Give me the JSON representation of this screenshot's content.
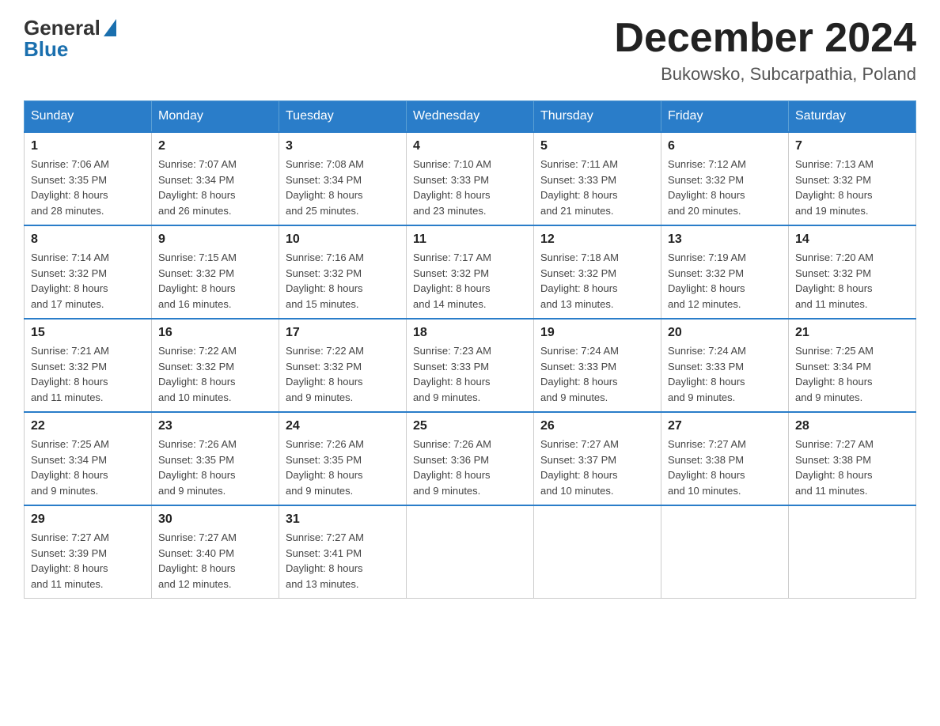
{
  "logo": {
    "general": "General",
    "blue": "Blue"
  },
  "header": {
    "title": "December 2024",
    "location": "Bukowsko, Subcarpathia, Poland"
  },
  "weekdays": [
    "Sunday",
    "Monday",
    "Tuesday",
    "Wednesday",
    "Thursday",
    "Friday",
    "Saturday"
  ],
  "weeks": [
    [
      {
        "day": "1",
        "sunrise": "7:06 AM",
        "sunset": "3:35 PM",
        "daylight": "8 hours and 28 minutes."
      },
      {
        "day": "2",
        "sunrise": "7:07 AM",
        "sunset": "3:34 PM",
        "daylight": "8 hours and 26 minutes."
      },
      {
        "day": "3",
        "sunrise": "7:08 AM",
        "sunset": "3:34 PM",
        "daylight": "8 hours and 25 minutes."
      },
      {
        "day": "4",
        "sunrise": "7:10 AM",
        "sunset": "3:33 PM",
        "daylight": "8 hours and 23 minutes."
      },
      {
        "day": "5",
        "sunrise": "7:11 AM",
        "sunset": "3:33 PM",
        "daylight": "8 hours and 21 minutes."
      },
      {
        "day": "6",
        "sunrise": "7:12 AM",
        "sunset": "3:32 PM",
        "daylight": "8 hours and 20 minutes."
      },
      {
        "day": "7",
        "sunrise": "7:13 AM",
        "sunset": "3:32 PM",
        "daylight": "8 hours and 19 minutes."
      }
    ],
    [
      {
        "day": "8",
        "sunrise": "7:14 AM",
        "sunset": "3:32 PM",
        "daylight": "8 hours and 17 minutes."
      },
      {
        "day": "9",
        "sunrise": "7:15 AM",
        "sunset": "3:32 PM",
        "daylight": "8 hours and 16 minutes."
      },
      {
        "day": "10",
        "sunrise": "7:16 AM",
        "sunset": "3:32 PM",
        "daylight": "8 hours and 15 minutes."
      },
      {
        "day": "11",
        "sunrise": "7:17 AM",
        "sunset": "3:32 PM",
        "daylight": "8 hours and 14 minutes."
      },
      {
        "day": "12",
        "sunrise": "7:18 AM",
        "sunset": "3:32 PM",
        "daylight": "8 hours and 13 minutes."
      },
      {
        "day": "13",
        "sunrise": "7:19 AM",
        "sunset": "3:32 PM",
        "daylight": "8 hours and 12 minutes."
      },
      {
        "day": "14",
        "sunrise": "7:20 AM",
        "sunset": "3:32 PM",
        "daylight": "8 hours and 11 minutes."
      }
    ],
    [
      {
        "day": "15",
        "sunrise": "7:21 AM",
        "sunset": "3:32 PM",
        "daylight": "8 hours and 11 minutes."
      },
      {
        "day": "16",
        "sunrise": "7:22 AM",
        "sunset": "3:32 PM",
        "daylight": "8 hours and 10 minutes."
      },
      {
        "day": "17",
        "sunrise": "7:22 AM",
        "sunset": "3:32 PM",
        "daylight": "8 hours and 9 minutes."
      },
      {
        "day": "18",
        "sunrise": "7:23 AM",
        "sunset": "3:33 PM",
        "daylight": "8 hours and 9 minutes."
      },
      {
        "day": "19",
        "sunrise": "7:24 AM",
        "sunset": "3:33 PM",
        "daylight": "8 hours and 9 minutes."
      },
      {
        "day": "20",
        "sunrise": "7:24 AM",
        "sunset": "3:33 PM",
        "daylight": "8 hours and 9 minutes."
      },
      {
        "day": "21",
        "sunrise": "7:25 AM",
        "sunset": "3:34 PM",
        "daylight": "8 hours and 9 minutes."
      }
    ],
    [
      {
        "day": "22",
        "sunrise": "7:25 AM",
        "sunset": "3:34 PM",
        "daylight": "8 hours and 9 minutes."
      },
      {
        "day": "23",
        "sunrise": "7:26 AM",
        "sunset": "3:35 PM",
        "daylight": "8 hours and 9 minutes."
      },
      {
        "day": "24",
        "sunrise": "7:26 AM",
        "sunset": "3:35 PM",
        "daylight": "8 hours and 9 minutes."
      },
      {
        "day": "25",
        "sunrise": "7:26 AM",
        "sunset": "3:36 PM",
        "daylight": "8 hours and 9 minutes."
      },
      {
        "day": "26",
        "sunrise": "7:27 AM",
        "sunset": "3:37 PM",
        "daylight": "8 hours and 10 minutes."
      },
      {
        "day": "27",
        "sunrise": "7:27 AM",
        "sunset": "3:38 PM",
        "daylight": "8 hours and 10 minutes."
      },
      {
        "day": "28",
        "sunrise": "7:27 AM",
        "sunset": "3:38 PM",
        "daylight": "8 hours and 11 minutes."
      }
    ],
    [
      {
        "day": "29",
        "sunrise": "7:27 AM",
        "sunset": "3:39 PM",
        "daylight": "8 hours and 11 minutes."
      },
      {
        "day": "30",
        "sunrise": "7:27 AM",
        "sunset": "3:40 PM",
        "daylight": "8 hours and 12 minutes."
      },
      {
        "day": "31",
        "sunrise": "7:27 AM",
        "sunset": "3:41 PM",
        "daylight": "8 hours and 13 minutes."
      },
      null,
      null,
      null,
      null
    ]
  ],
  "labels": {
    "sunrise": "Sunrise:",
    "sunset": "Sunset:",
    "daylight": "Daylight:"
  }
}
